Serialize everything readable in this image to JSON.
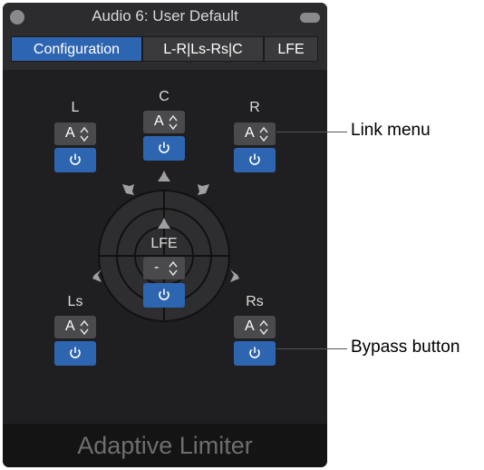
{
  "window": {
    "title": "Audio 6: User Default",
    "footer_title": "Adaptive Limiter"
  },
  "tabs": [
    {
      "label": "Configuration",
      "active": true
    },
    {
      "label": "L-R|Ls-Rs|C",
      "active": false
    },
    {
      "label": "LFE",
      "active": false
    }
  ],
  "channels": {
    "L": {
      "label": "L",
      "link_value": "A"
    },
    "C": {
      "label": "C",
      "link_value": "A"
    },
    "R": {
      "label": "R",
      "link_value": "A"
    },
    "LFE": {
      "label": "LFE",
      "link_value": "-"
    },
    "Ls": {
      "label": "Ls",
      "link_value": "A"
    },
    "Rs": {
      "label": "Rs",
      "link_value": "A"
    }
  },
  "icons": {
    "close": "close-dot-icon",
    "zoom": "zoom-pill-icon",
    "bypass": "power-icon",
    "link_arrows": "up-down-chevron-icon",
    "speaker": "speaker-icon"
  },
  "colors": {
    "accent": "#2e65b0",
    "panel": "#1f1f21",
    "button": "#4a4a4c"
  },
  "callouts": {
    "link_menu": "Link menu",
    "bypass_button": "Bypass button"
  }
}
